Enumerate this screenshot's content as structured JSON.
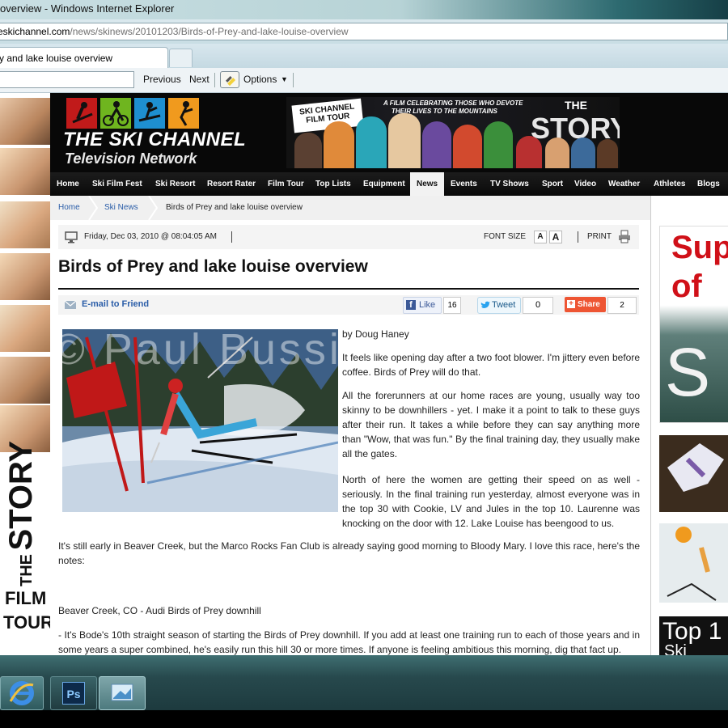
{
  "window": {
    "title": "overview - Windows Internet Explorer"
  },
  "address": {
    "domain": "eskichannel.com",
    "path": "/news/skinews/20101203/Birds-of-Prey-and-lake-louise-overview"
  },
  "tabs": [
    {
      "label": "y and lake louise overview"
    }
  ],
  "findbar": {
    "previous_label": "Previous",
    "next_label": "Next",
    "options_label": "Options"
  },
  "site": {
    "logo_line1": "THE SKI CHANNEL",
    "logo_line2": "Television Network",
    "banner": {
      "badge_line1": "SKI CHANNEL",
      "badge_line2": "FILM TOUR",
      "tagline_line1": "A FILM CELEBRATING THOSE WHO DEVOTE",
      "tagline_line2": "THEIR LIVES TO THE MOUNTAINS",
      "title_small": "THE",
      "title_big": "STORY"
    },
    "nav": [
      "Home",
      "Ski Film Fest",
      "Ski Resort",
      "Resort Rater",
      "Film Tour",
      "Top Lists",
      "Equipment",
      "News",
      "Events",
      "TV Shows",
      "Sport",
      "Video",
      "Weather",
      "Athletes",
      "Blogs"
    ],
    "nav_active": "News",
    "left_promo": {
      "the": "THE",
      "story": "STORY",
      "film": "FILM",
      "tour": "TOUR"
    }
  },
  "breadcrumb": [
    "Home",
    "Ski News",
    "Birds of Prey and lake louise overview"
  ],
  "article": {
    "date": "Friday, Dec 03, 2010 @ 08:04:05 AM",
    "font_size_label": "FONT SIZE",
    "font_a_small": "A",
    "font_a_large": "A",
    "print_label": "PRINT",
    "title": "Birds of Prey and lake louise overview",
    "email_label": "E-mail to Friend",
    "like_label": "Like",
    "like_count": "16",
    "tweet_label": "Tweet",
    "tweet_count": "0",
    "share_label": "Share",
    "share_count": "2",
    "photo_watermark": "© Paul Bussi 2010",
    "byline": "by Doug Haney",
    "p1": "It feels like opening day after a two foot blower. I'm jittery even before coffee. Birds of Prey will do that.",
    "p2": "All the forerunners at our home races are young, usually way too skinny to be downhillers - yet. I make it a point to talk to these guys after their run. It takes a while before they can say anything more than \"Wow, that was fun.\" By the final training day, they usually make all the gates.",
    "p3": "North of here the women are getting their speed on as well - seriously. In the final training run yesterday, almost everyone was in the top 30 with Cookie, LV and Jules in the top 10. Laurenne was knocking on the door with 12. Lake Louise has beengood to us.",
    "p4": "It's still early in Beaver Creek, but the Marco Rocks Fan Club is already saying good morning to Bloody Mary. I love this race, here's the notes:",
    "p5": "Beaver Creek, CO - Audi Birds of Prey downhill",
    "p6": "- It's Bode's 10th straight season of starting the Birds of Prey downhill. If you add at least one training run to each of those years and in some years a super combined, he's easily run this hill 30 or more times. If anyone is feeling ambitious this morning, dig that fact up."
  },
  "right_ads": {
    "ad1_line1": "Sup",
    "ad1_line2": "of",
    "ad1_big": "S",
    "ad4_line1": "Top 1",
    "ad4_line2": "Ski"
  },
  "taskbar": {
    "ps_label": "Ps"
  },
  "colors": {
    "nav_bg": "#0a0a0a",
    "link_blue": "#2a5da8",
    "share_orange": "#ee5533",
    "ad_red": "#d01018"
  }
}
